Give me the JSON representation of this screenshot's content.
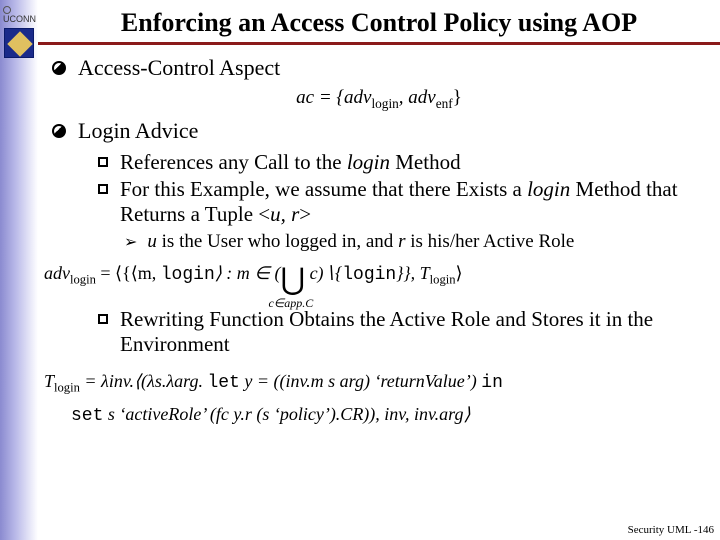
{
  "brand": "UCONN",
  "title": "Enforcing an Access Control Policy using AOP",
  "b1a": "Access-Control Aspect",
  "f1_pre": "ac = {adv",
  "f1_s1": "login",
  "f1_mid": ", adv",
  "f1_s2": "enf",
  "f1_post": "}",
  "b1b": "Login Advice",
  "b2a_pre": "References any Call to the ",
  "b2a_it": "login",
  "b2a_post": " Method",
  "b2b_pre": "For this Example, we assume that there Exists a ",
  "b2b_it": "login",
  "b2b_mid": " Method that Returns a Tuple <",
  "b2b_u": "u, r",
  "b2b_post": ">",
  "b3_u": "u",
  "b3_mid1": " is the User who logged in, and ",
  "b3_r": "r",
  "b3_mid2": " is his/her Active Role",
  "f2_a": "adv",
  "f2_a_sub": "login",
  "f2_b": " = ⟨{⟨m, ",
  "f2_login": "login",
  "f2_c": "⟩ : m ∈ (",
  "f2_cup_sub": "c∈app.C",
  "f2_d": " c)∖{",
  "f2_login2": "login",
  "f2_e": "}}, T",
  "f2_e_sub": "login",
  "f2_f": "⟩",
  "b2c": "Rewriting Function Obtains the Active Role and Stores it in the Environment",
  "f3_a": "T",
  "f3_a_sub": "login",
  "f3_b": " = λinv.⟨(λs.λarg. ",
  "f3_let": "let",
  "f3_c": " y = ((inv.m s arg) ‘returnValue’) ",
  "f3_in": "in",
  "f3_d1": "set",
  "f3_d2": " s ‘activeRole’ (fc y.r (s ‘policy’).CR)), inv, inv.arg⟩",
  "footer": "Security UML -146"
}
